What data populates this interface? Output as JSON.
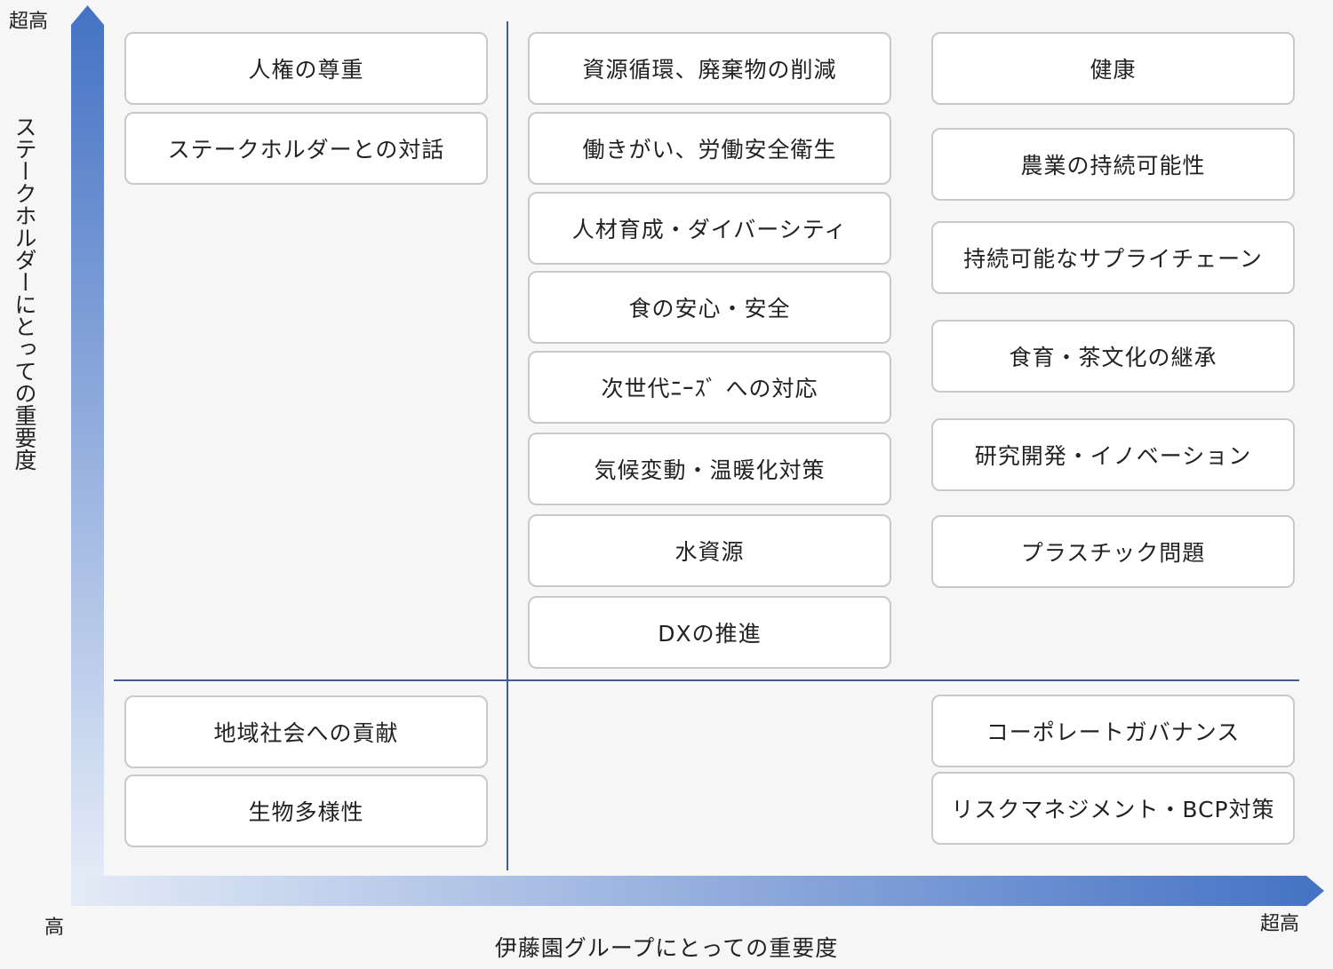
{
  "axes": {
    "y_title": "ステークホルダーにとっての重要度",
    "y_top_label": "超高",
    "x_title": "伊藤園グループにとっての重要度",
    "x_origin_label": "高",
    "x_end_label": "超高",
    "arrow_color_strong": "#4472c4",
    "arrow_color_light": "#dfe7f5"
  },
  "quadrants": {
    "left_upper": [
      "人権の尊重",
      "ステークホルダーとの対話"
    ],
    "middle_upper": [
      "資源循環、廃棄物の削減",
      "働きがい、労働安全衛生",
      "人材育成・ダイバーシティ",
      "食の安心・安全",
      "次世代ﾆｰｽﾞ への対応",
      "気候変動・温暖化対策",
      "水資源",
      "DXの推進"
    ],
    "right_upper": [
      "健康",
      "農業の持続可能性",
      "持続可能なサプライチェーン",
      "食育・茶文化の継承",
      "研究開発・イノベーション",
      "プラスチック問題"
    ],
    "left_lower": [
      "地域社会への貢献",
      "生物多様性"
    ],
    "right_lower": [
      "コーポレートガバナンス",
      "リスクマネジメント・BCP対策"
    ]
  }
}
